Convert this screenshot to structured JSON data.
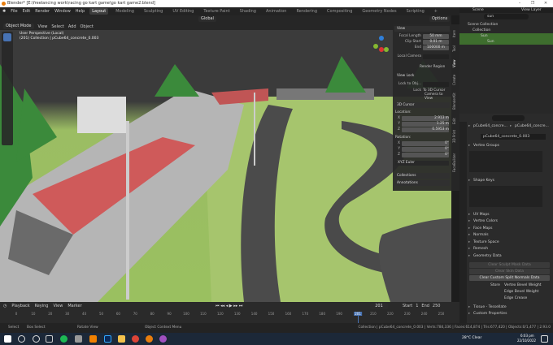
{
  "window": {
    "title": "Blender* [E:\\freelancing work\\racing go kart game\\go kart game2.blend]",
    "minimize": "–",
    "maximize": "❐",
    "close": "✕"
  },
  "menu": [
    "File",
    "Edit",
    "Render",
    "Window",
    "Help"
  ],
  "workspaces": [
    "Layout",
    "Modeling",
    "Sculpting",
    "UV Editing",
    "Texture Paint",
    "Shading",
    "Animation",
    "Rendering",
    "Compositing",
    "Geometry Nodes",
    "Scripting",
    "+"
  ],
  "viewport": {
    "mode": "Object Mode",
    "menus": [
      "View",
      "Select",
      "Add",
      "Object"
    ],
    "orientation": "Global",
    "options": "Options",
    "overlay_title": "User Perspective (Local)",
    "overlay_sub": "(201) Collection | pCube64_concrete_0.003"
  },
  "npanel": {
    "view_header": "View",
    "focal_length_label": "Focal Length",
    "focal_length": "50 mm",
    "clip_start_label": "Clip Start",
    "clip_start": "0.01 m",
    "clip_end_label": "End",
    "clip_end": "100000 m",
    "local_camera_label": "Local Camera",
    "render_region": "Render Region",
    "view_lock_header": "View Lock",
    "lock_to_obj_label": "Lock to Obj...",
    "lock_label": "Lock",
    "to_3d_cursor": "To 3D Cursor",
    "camera_to_view": "Camera to View",
    "cursor_header": "3D Cursor",
    "location_label": "Location:",
    "rotation_label": "Rotation:",
    "loc": [
      {
        "axis": "X",
        "value": "2.913 m"
      },
      {
        "axis": "Y",
        "value": "1.25 m"
      },
      {
        "axis": "Z",
        "value": "0.5953 m"
      }
    ],
    "rot": [
      {
        "axis": "X",
        "value": "0°"
      },
      {
        "axis": "Y",
        "value": "0°"
      },
      {
        "axis": "Z",
        "value": "0°"
      }
    ],
    "rotation_mode": "XYZ Euler",
    "collections": "Collections",
    "annotations": "Annotations",
    "tabs": [
      "Item",
      "Tool",
      "View",
      "Create",
      "BlenderKit",
      "Edit",
      "3D Print",
      "FaceBuilder"
    ]
  },
  "outliner": {
    "scene": "Scene",
    "view_layer": "View Layer",
    "search": "sun",
    "rows": [
      "Scene Collection",
      "Collection",
      "Sun",
      "Sun"
    ]
  },
  "properties": {
    "object_name": "pCube64_concre...",
    "mesh_name_short": "pCube64_concre...",
    "mesh_name": "pCube64_concrete_0.003",
    "vertex_groups": "Vertex Groups",
    "shape_keys": "Shape Keys",
    "panels": [
      "UV Maps",
      "Vertex Colors",
      "Face Maps",
      "Normals",
      "Texture Space",
      "Remesh",
      "Geometry Data"
    ],
    "clear_sculpt": "Clear Sculpt Mask Data",
    "clear_skin": "Clear Skin Data",
    "clear_split": "Clear Custom Split Normals Data",
    "store_label": "Store",
    "store_opts": [
      "Vertex Bevel Weight",
      "Edge Bevel Weight",
      "Edge Crease"
    ],
    "subpanels": [
      "Tissue - Tessellate",
      "Custom Properties"
    ]
  },
  "timeline": {
    "menus": [
      "Playback",
      "Keying",
      "View",
      "Marker"
    ],
    "current_frame": "201",
    "start_label": "Start",
    "start": "1",
    "end_label": "End",
    "end": "250",
    "ticks": [
      "0",
      "10",
      "20",
      "30",
      "40",
      "50",
      "60",
      "70",
      "80",
      "90",
      "100",
      "110",
      "120",
      "130",
      "140",
      "150",
      "160",
      "170",
      "180",
      "190",
      "201",
      "210",
      "220",
      "230",
      "240",
      "250"
    ]
  },
  "status": {
    "select": "Select",
    "box_select": "Box Select",
    "rotate": "Rotate View",
    "context": "Object Context Menu",
    "stats": "Collection | pCube64_concrete_0.003 | Verts:784,336 | Faces:614,874 | Tris:677,420 | Objects:0/1,477 | 2.93.0"
  },
  "taskbar": {
    "weather": "28°C  Clear",
    "time": "6:03 pm",
    "date": "22/10/2022"
  }
}
